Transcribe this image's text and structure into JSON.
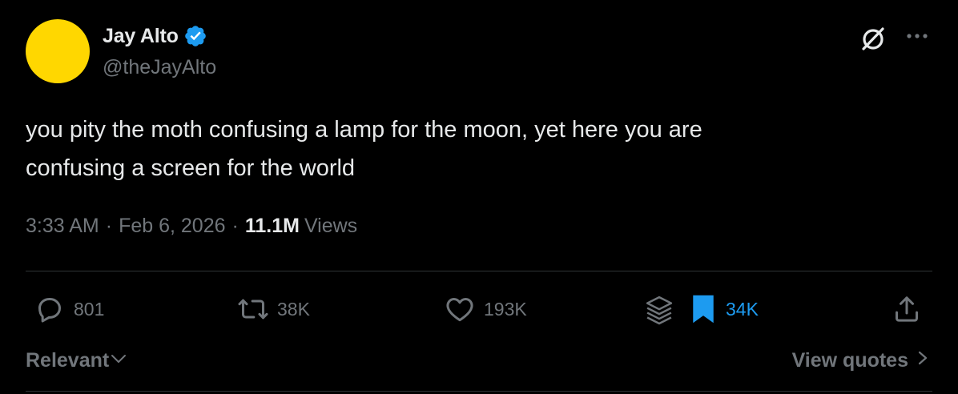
{
  "author": {
    "display_name": "Jay Alto",
    "handle": "@theJayAlto",
    "verified": true
  },
  "tweet": {
    "text_line1": "you pity the moth confusing a lamp for the moon, yet here you are",
    "text_line2": "confusing a screen for the world",
    "time": "3:33 AM",
    "date": "Feb 6, 2026",
    "separator": "·",
    "views_count": "11.1M",
    "views_label": "Views"
  },
  "actions": {
    "replies": "801",
    "reposts": "38K",
    "likes": "193K",
    "bookmarks": "34K",
    "bookmarked": true
  },
  "footer": {
    "sort_label": "Relevant",
    "view_quotes_label": "View quotes"
  },
  "icons": {
    "verified": "verified-badge-icon",
    "grok": "grok-icon",
    "more": "more-icon",
    "reply": "reply-icon",
    "repost": "repost-icon",
    "like": "heart-icon",
    "grok_action": "grok-icon",
    "bookmark": "bookmark-icon",
    "share": "share-icon"
  },
  "colors": {
    "background": "#000000",
    "text_primary": "#e7e9ea",
    "text_secondary": "#71767b",
    "accent": "#1d9bf0",
    "avatar": "#ffd700",
    "divider": "#2f3336"
  }
}
